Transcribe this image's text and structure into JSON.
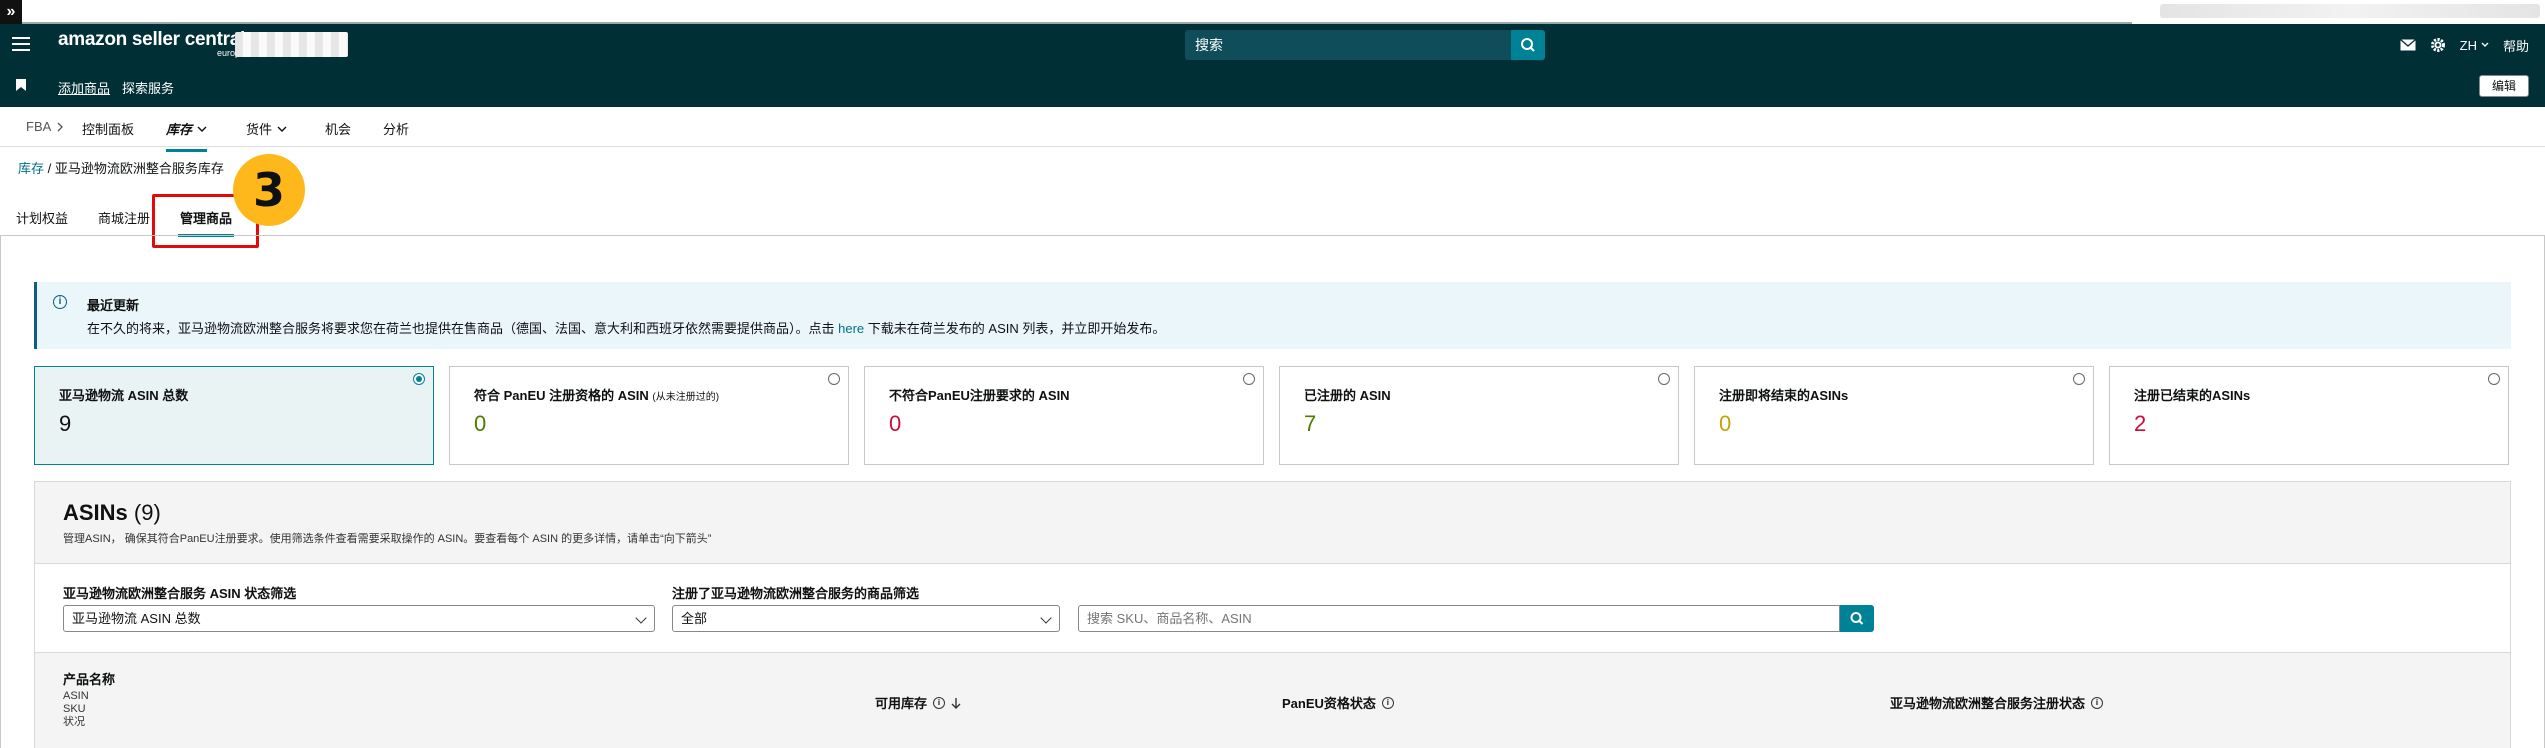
{
  "header": {
    "logo_main": "amazon seller central",
    "logo_region": "europe",
    "search_placeholder": "搜索",
    "lang": "ZH",
    "help": "帮助"
  },
  "subbar": {
    "link_add_product": "添加商品",
    "link_explore": "探索服务",
    "edit": "编辑"
  },
  "nav": {
    "fba": "FBA",
    "items": [
      "控制面板",
      "库存",
      "货件",
      "机会",
      "分析"
    ]
  },
  "breadcrumb": {
    "root": "库存",
    "current": "/ 亚马逊物流欧洲整合服务库存"
  },
  "tabs": [
    "计划权益",
    "商城注册",
    "管理商品"
  ],
  "annotation_number": "3",
  "alert": {
    "title": "最近更新",
    "text_before": "在不久的将来，亚马逊物流欧洲整合服务将要求您在荷兰也提供在售商品（德国、法国、意大利和西班牙依然需要提供商品）。点击",
    "link": "here",
    "text_after": "下载未在荷兰发布的 ASIN 列表，并立即开始发布。"
  },
  "cards": [
    {
      "label": "亚马逊物流 ASIN 总数",
      "note": "",
      "value": "9",
      "color": "#0f1111"
    },
    {
      "label": "符合 PanEU 注册资格的 ASIN",
      "note": "(从未注册过的)",
      "value": "0",
      "color": "#507a00"
    },
    {
      "label": "不符合PanEU注册要求的 ASIN",
      "note": "",
      "value": "0",
      "color": "#cc0c39"
    },
    {
      "label": "已注册的 ASIN",
      "note": "",
      "value": "7",
      "color": "#507a00"
    },
    {
      "label": "注册即将结束的ASINs",
      "note": "",
      "value": "0",
      "color": "#c7a200"
    },
    {
      "label": "注册已结束的ASINs",
      "note": "",
      "value": "2",
      "color": "#cc0c39"
    }
  ],
  "panel": {
    "title": "ASINs",
    "count": "(9)",
    "subtitle": "管理ASIN， 确保其符合PanEU注册要求。使用筛选条件查看需要采取操作的 ASIN。要查看每个 ASIN 的更多详情，请单击“向下箭头”",
    "filter1_label": "亚马逊物流欧洲整合服务 ASIN 状态筛选",
    "filter1_value": "亚马逊物流 ASIN 总数",
    "filter2_label": "注册了亚马逊物流欧洲整合服务的商品筛选",
    "filter2_value": "全部",
    "search_placeholder": "搜索 SKU、商品名称、ASIN"
  },
  "table": {
    "col_product": "产品名称",
    "sub_asin": "ASIN",
    "sub_sku": "SKU",
    "sub_status": "状况",
    "col_stock": "可用库存",
    "col_paneu": "PanEU资格状态",
    "col_reg": "亚马逊物流欧洲整合服务注册状态"
  }
}
